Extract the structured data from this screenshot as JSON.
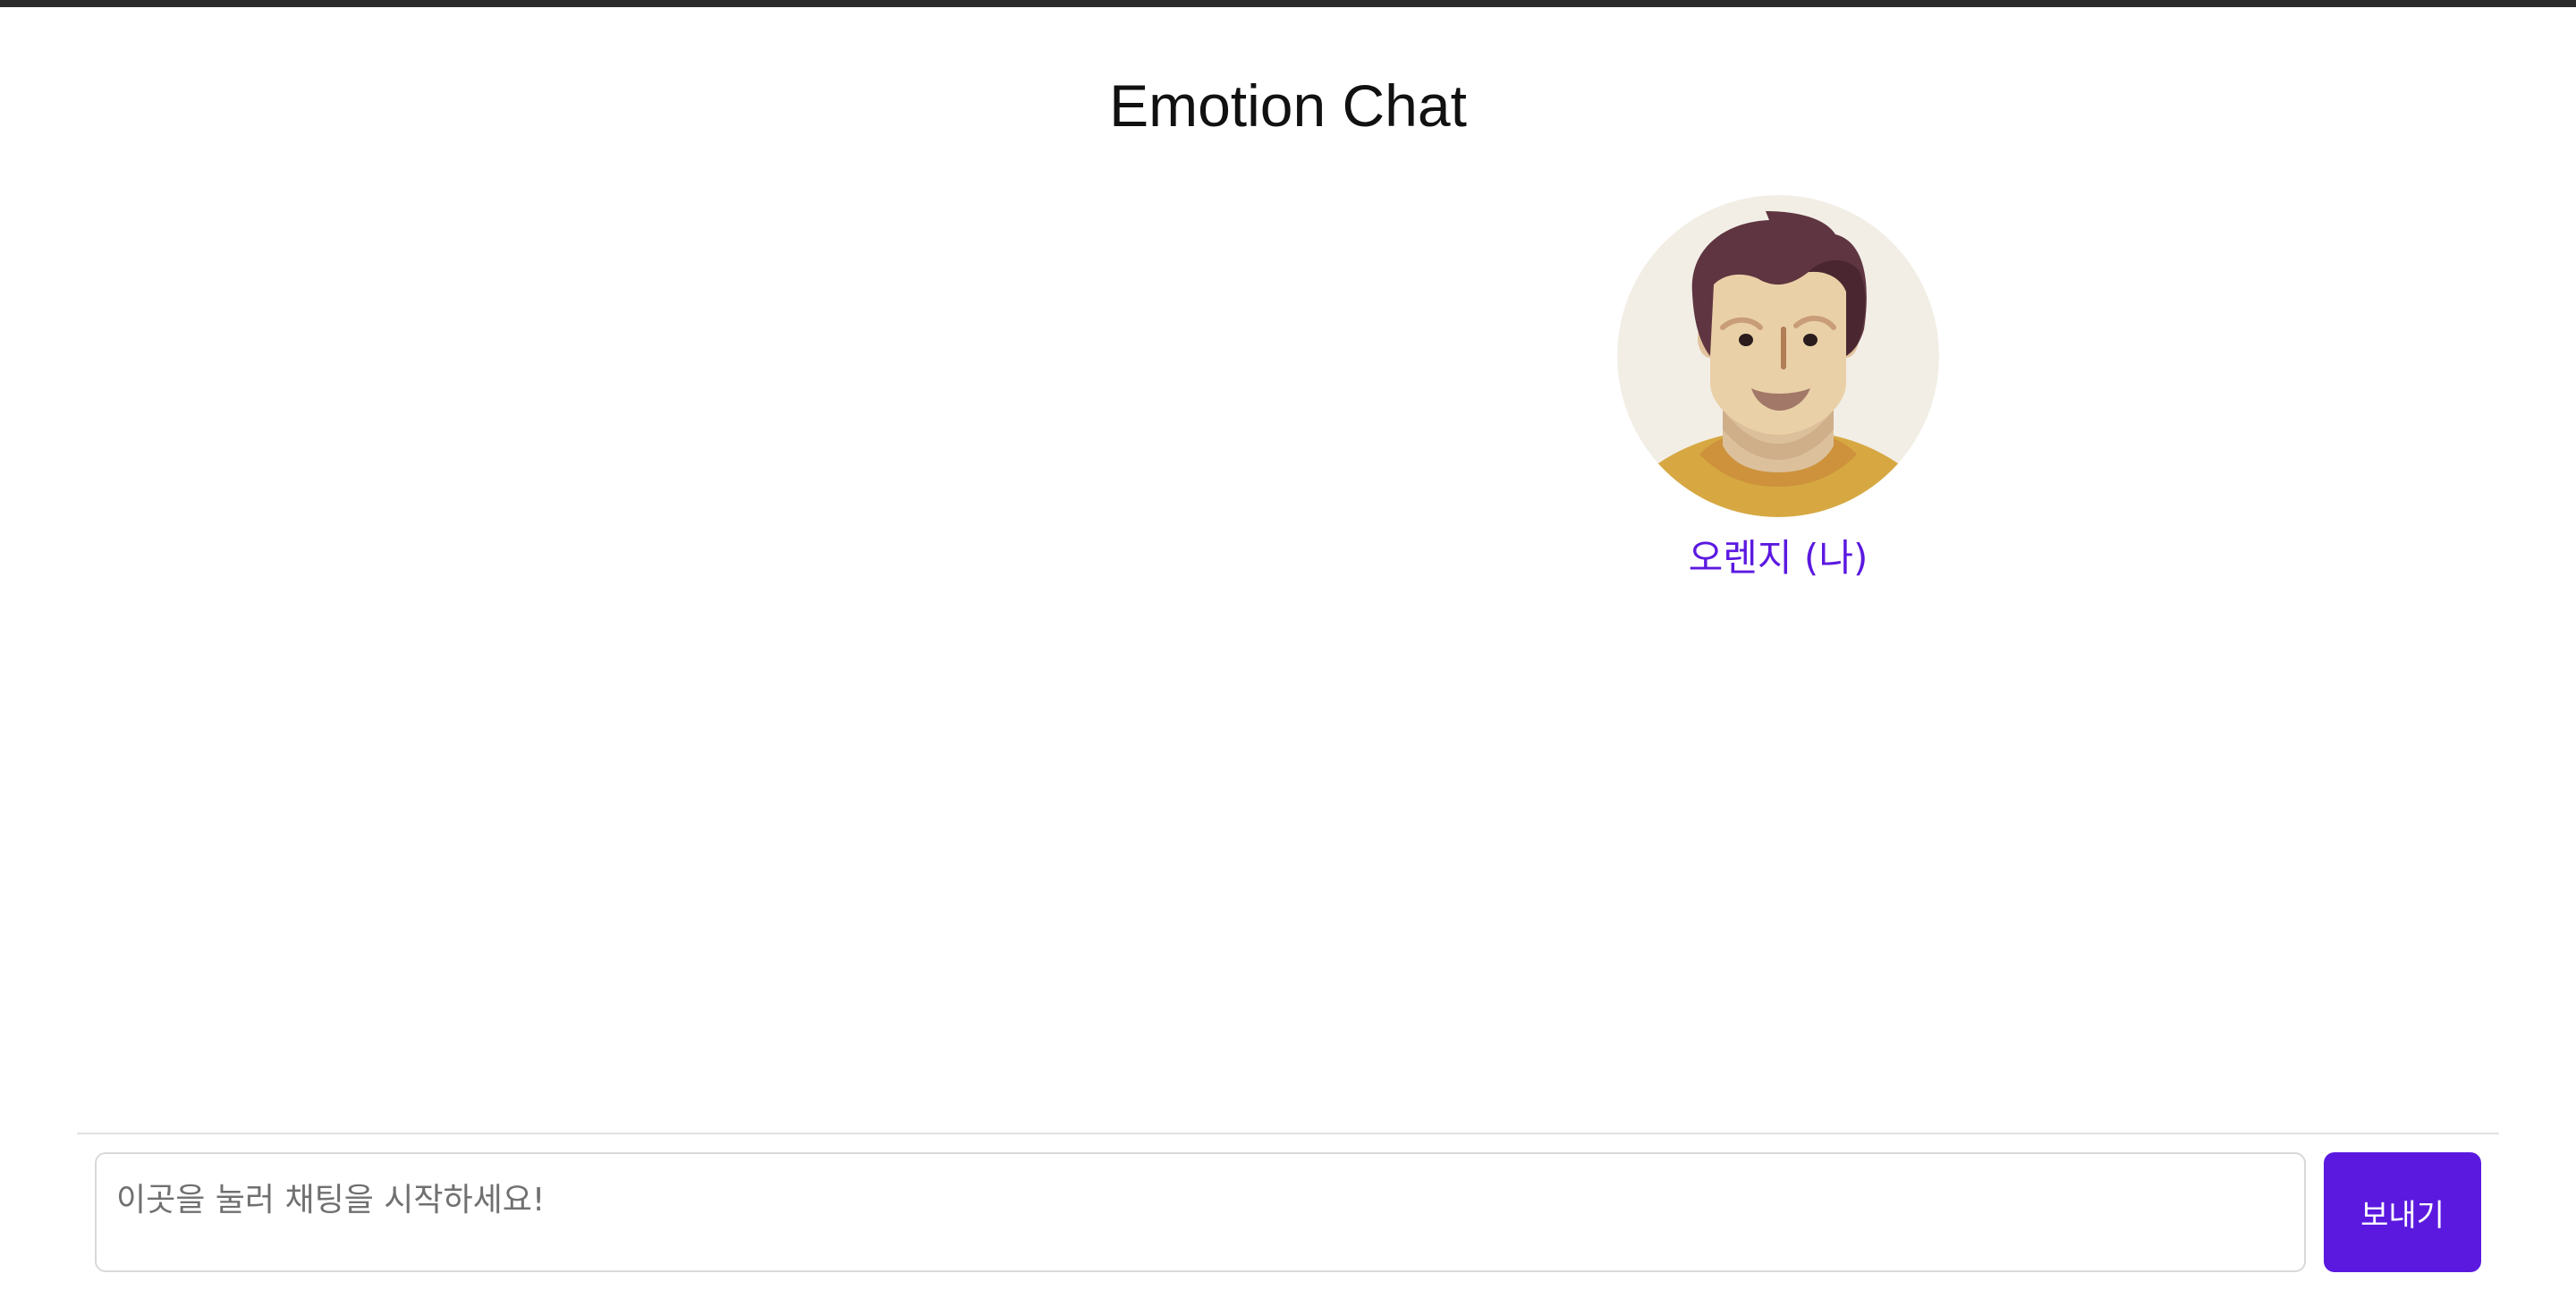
{
  "app": {
    "title": "Emotion Chat"
  },
  "participants": [
    {
      "name": "오렌지 (나)",
      "avatar_icon": "man-avatar-icon",
      "name_color": "#5b19e0"
    }
  ],
  "composer": {
    "placeholder": "이곳을 눌러 채팅을 시작하세요!",
    "value": "",
    "send_label": "보내기"
  },
  "colors": {
    "accent": "#5b19e0",
    "top_bar": "#2b2b2b"
  }
}
